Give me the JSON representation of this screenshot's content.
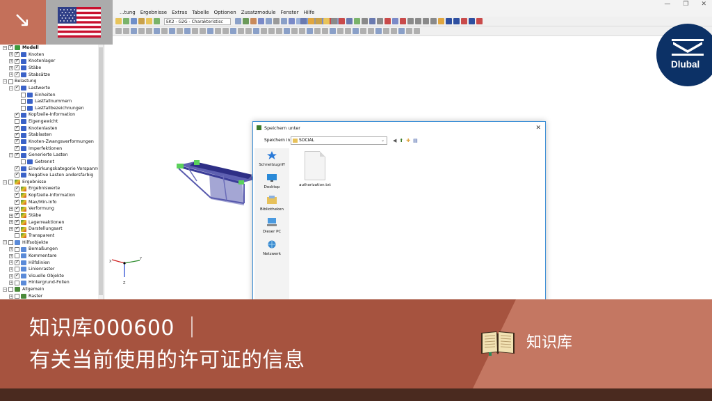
{
  "app": {
    "menus": [
      "...tung",
      "Ergebnisse",
      "Extras",
      "Tabelle",
      "Optionen",
      "Zusatzmodule",
      "Fenster",
      "Hilfe"
    ],
    "load_case_combo": "EK2 - G2G - Charakteristisc",
    "window_controls": [
      "—",
      "❐",
      "✕"
    ]
  },
  "navigator": {
    "items": [
      {
        "label": "Modell",
        "level": 0,
        "expander": "−",
        "checked": true,
        "icon": "model-icon",
        "bold": true
      },
      {
        "label": "Knoten",
        "level": 1,
        "expander": "+",
        "checked": true,
        "icon": "node-icon"
      },
      {
        "label": "Knotenlager",
        "level": 1,
        "expander": "+",
        "checked": true,
        "icon": "support-icon"
      },
      {
        "label": "Stäbe",
        "level": 1,
        "expander": "+",
        "checked": true,
        "icon": "member-icon"
      },
      {
        "label": "Stabsätze",
        "level": 1,
        "expander": "+",
        "checked": true,
        "icon": "member-set-icon"
      },
      {
        "label": "Belastung",
        "level": 0,
        "expander": "−",
        "checked": false,
        "icon": ""
      },
      {
        "label": "Lastwerte",
        "level": 1,
        "expander": "−",
        "checked": true,
        "icon": "load-icon"
      },
      {
        "label": "Einheiten",
        "level": 2,
        "expander": "",
        "checked": false,
        "icon": "load-icon"
      },
      {
        "label": "Lastfallnummern",
        "level": 2,
        "expander": "",
        "checked": false,
        "icon": "load-icon"
      },
      {
        "label": "Lastfallbezeichnungen",
        "level": 2,
        "expander": "",
        "checked": false,
        "icon": "load-icon"
      },
      {
        "label": "Kopfzeile-Information",
        "level": 1,
        "expander": "",
        "checked": true,
        "icon": "load-icon"
      },
      {
        "label": "Eigengewicht",
        "level": 1,
        "expander": "",
        "checked": false,
        "icon": "load-icon"
      },
      {
        "label": "Knotenlasten",
        "level": 1,
        "expander": "",
        "checked": true,
        "icon": "load-icon"
      },
      {
        "label": "Stablasten",
        "level": 1,
        "expander": "",
        "checked": true,
        "icon": "load-icon"
      },
      {
        "label": "Knoten-Zwangsverformungen",
        "level": 1,
        "expander": "",
        "checked": true,
        "icon": "load-icon"
      },
      {
        "label": "Imperfektionen",
        "level": 1,
        "expander": "",
        "checked": true,
        "icon": "load-icon"
      },
      {
        "label": "Generierte Lasten",
        "level": 1,
        "expander": "−",
        "checked": true,
        "icon": "load-icon"
      },
      {
        "label": "Getrennt",
        "level": 2,
        "expander": "",
        "checked": false,
        "icon": "load-icon"
      },
      {
        "label": "Einwirkungskategorie Vorspannu",
        "level": 1,
        "expander": "",
        "checked": true,
        "icon": "load-icon"
      },
      {
        "label": "Negative Lasten andersfarbig",
        "level": 1,
        "expander": "",
        "checked": true,
        "icon": "load-icon"
      },
      {
        "label": "Ergebnisse",
        "level": 0,
        "expander": "−",
        "checked": false,
        "icon": "result-icon"
      },
      {
        "label": "Ergebniswerte",
        "level": 1,
        "expander": "",
        "checked": true,
        "icon": "result-icon"
      },
      {
        "label": "Kopfzeile-Information",
        "level": 1,
        "expander": "",
        "checked": true,
        "icon": "result-icon"
      },
      {
        "label": "Max/Min-Info",
        "level": 1,
        "expander": "",
        "checked": true,
        "icon": "result-icon"
      },
      {
        "label": "Verformung",
        "level": 1,
        "expander": "+",
        "checked": true,
        "icon": "result-icon"
      },
      {
        "label": "Stäbe",
        "level": 1,
        "expander": "+",
        "checked": true,
        "icon": "result-icon"
      },
      {
        "label": "Lagerreaktionen",
        "level": 1,
        "expander": "+",
        "checked": true,
        "icon": "result-icon"
      },
      {
        "label": "Darstellungsart",
        "level": 1,
        "expander": "+",
        "checked": true,
        "icon": "result-icon"
      },
      {
        "label": "Transparent",
        "level": 1,
        "expander": "",
        "checked": false,
        "icon": "result-icon"
      },
      {
        "label": "Hilfsobjekte",
        "level": 0,
        "expander": "−",
        "checked": false,
        "icon": "aux-icon"
      },
      {
        "label": "Bemaßungen",
        "level": 1,
        "expander": "+",
        "checked": false,
        "icon": "aux-icon"
      },
      {
        "label": "Kommentare",
        "level": 1,
        "expander": "+",
        "checked": false,
        "icon": "aux-icon"
      },
      {
        "label": "Hilfslinien",
        "level": 1,
        "expander": "+",
        "checked": true,
        "icon": "aux-icon"
      },
      {
        "label": "Linienraster",
        "level": 1,
        "expander": "+",
        "checked": false,
        "icon": "aux-icon"
      },
      {
        "label": "Visuelle Objekte",
        "level": 1,
        "expander": "+",
        "checked": true,
        "icon": "aux-icon"
      },
      {
        "label": "Hintergrund-Folien",
        "level": 1,
        "expander": "+",
        "checked": false,
        "icon": "aux-icon"
      },
      {
        "label": "Allgemein",
        "level": 0,
        "expander": "−",
        "checked": false,
        "icon": "general-icon"
      },
      {
        "label": "Raster",
        "level": 1,
        "expander": "+",
        "checked": false,
        "icon": "general-icon"
      }
    ]
  },
  "axes": {
    "x": "X",
    "y": "Y",
    "z": "Z"
  },
  "save_dialog": {
    "title": "Speichern unter",
    "close": "✕",
    "location_label": "Speichern in:",
    "location_value": "SOCIAL",
    "places": [
      {
        "label": "Schnellzugriff",
        "icon": "star-icon"
      },
      {
        "label": "Desktop",
        "icon": "desktop-icon"
      },
      {
        "label": "Bibliotheken",
        "icon": "library-icon"
      },
      {
        "label": "Dieser PC",
        "icon": "computer-icon"
      },
      {
        "label": "Netzwerk",
        "icon": "network-icon"
      }
    ],
    "files": [
      {
        "name": "authorization.txt",
        "icon": "text-file-icon"
      }
    ]
  },
  "branding": {
    "logo_text": "Dlubal",
    "flag": "us-flag-icon",
    "corner_arrow": "↘"
  },
  "banner": {
    "title": "知识库000600 ｜",
    "subtitle": "有关当前使用的许可证的信息",
    "category_label": "知识库"
  },
  "colors": {
    "banner_dark": "#a6533f",
    "banner_light": "#c47762",
    "logo_blue": "#0c3166",
    "accent": "#3c8fd6"
  }
}
